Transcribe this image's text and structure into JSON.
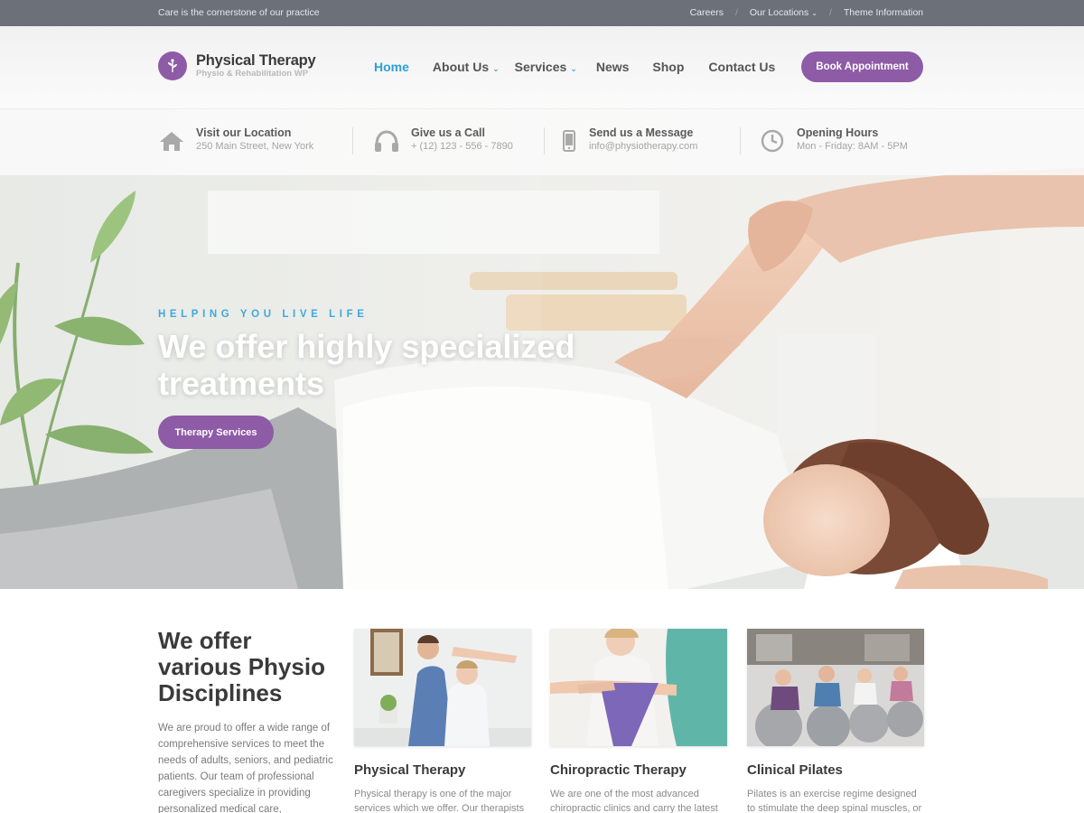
{
  "topbar": {
    "tagline": "Care is the cornerstone of our practice",
    "links": [
      "Careers",
      "Our Locations",
      "Theme Information"
    ]
  },
  "logo": {
    "name": "Physical Therapy",
    "subtitle": "Physio & Rehabilitation WP"
  },
  "nav": {
    "items": [
      "Home",
      "About Us",
      "Services",
      "News",
      "Shop",
      "Contact Us"
    ],
    "active": "Home"
  },
  "header": {
    "cta": "Book Appointment"
  },
  "info": [
    {
      "icon": "home-icon",
      "title": "Visit our Location",
      "detail": "250 Main Street, New York"
    },
    {
      "icon": "headset-icon",
      "title": "Give us a Call",
      "detail": "+ (12) 123 - 556 - 7890"
    },
    {
      "icon": "phone-icon",
      "title": "Send us a Message",
      "detail": "info@physiotherapy.com"
    },
    {
      "icon": "clock-icon",
      "title": "Opening Hours",
      "detail": "Mon - Friday: 8AM - 5PM"
    }
  ],
  "hero": {
    "kicker": "HELPING YOU LIVE LIFE",
    "title": "We offer highly specialized treatments",
    "button": "Therapy Services"
  },
  "intro": {
    "title": "We offer various Physio Disciplines",
    "text": "We are proud to offer a wide range of comprehensive services to meet the needs of adults, seniors, and pediatric patients. Our team of professional caregivers specialize in providing personalized medical care, rehabilitative"
  },
  "cards": [
    {
      "title": "Physical Therapy",
      "text": "Physical therapy is one of the major services which we offer. Our therapists"
    },
    {
      "title": "Chiropractic Therapy",
      "text": "We are one of the most advanced chiropractic clinics and carry the latest"
    },
    {
      "title": "Clinical Pilates",
      "text": "Pilates is an exercise regime designed to stimulate the deep spinal muscles, or"
    }
  ],
  "colors": {
    "accent": "#8e5ba6",
    "link": "#2ea0d8",
    "topbar": "#6b7079"
  }
}
